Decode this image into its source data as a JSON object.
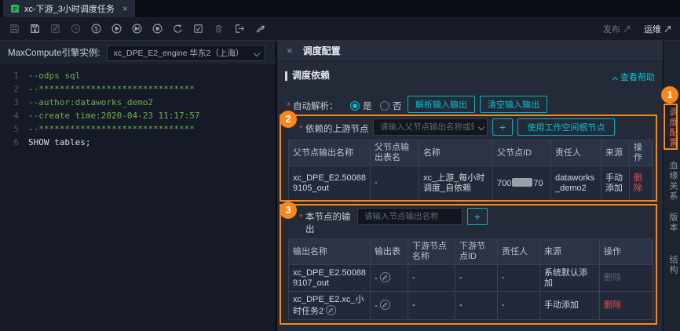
{
  "colors": {
    "accent_teal": "#00c4d6",
    "annotation_orange": "#f8871b",
    "danger_red": "#e2504c",
    "comment_green": "#6fae4e"
  },
  "tab_bar": {
    "active_tab": {
      "icon": "sql-node-icon",
      "title": "xc-下游_3小时调度任务",
      "close": "×"
    }
  },
  "toolbar": {
    "icons": [
      "save-icon",
      "save-commit-icon",
      "steal-lock-icon",
      "clock-icon",
      "cost-estimate-icon",
      "run-icon",
      "advanced-run-icon",
      "stop-icon",
      "refresh-icon",
      "syntax-check-icon",
      "clear-icon",
      "format-icon",
      "settings-wrench-icon"
    ],
    "publish_link": {
      "label": "发布",
      "arrow": "↗"
    },
    "ops_link": {
      "label": "运维",
      "arrow": "↗"
    }
  },
  "editor": {
    "engine_label": "MaxCompute引擎实例:",
    "engine_value": "xc_DPE_E2_engine 华东2（上海）",
    "lines": [
      {
        "no": "1",
        "text": "--odps sql"
      },
      {
        "no": "2",
        "text": "--******************************"
      },
      {
        "no": "3",
        "text": "--author:dataworks_demo2"
      },
      {
        "no": "4",
        "text": "--create time:2020-04-23 11:17:57"
      },
      {
        "no": "5",
        "text": "--******************************"
      },
      {
        "no": "6",
        "text": "SHOW tables;"
      }
    ]
  },
  "panel": {
    "close": "×",
    "title": "调度配置",
    "section": {
      "title": "调度依赖",
      "help": "查看帮助"
    },
    "auto_parse": {
      "required": "*",
      "label": "自动解析：",
      "option_yes": "是",
      "option_no": "否",
      "parse_button": "解析输入输出",
      "clear_button": "清空输入输出"
    },
    "upstream": {
      "required": "*",
      "label": "依赖的上游节点",
      "input_placeholder": "请输入父节点输出名称或输出表名",
      "add_button": "+",
      "root_button": "使用工作空间根节点",
      "headers": [
        "父节点输出名称",
        "父节点输出表名",
        "名称",
        "父节点ID",
        "责任人",
        "来源",
        "操作"
      ],
      "row": {
        "output_name": "xc_DPE_E2.500889105_out",
        "output_table": "-",
        "name": "xc_上游_每小时调度_自依赖",
        "parent_id_prefix": "700",
        "parent_id_suffix": "70",
        "owner": "dataworks_demo2",
        "source": "手动添加",
        "action": "删除"
      }
    },
    "outputs": {
      "required": "*",
      "label": "本节点的输出",
      "input_placeholder": "请输入节点输出名称",
      "add_button": "+",
      "headers": [
        "输出名称",
        "输出表",
        "下游节点名称",
        "下游节点ID",
        "责任人",
        "来源",
        "操作"
      ],
      "rows": [
        {
          "name": "xc_DPE_E2.500889107_out",
          "table": "-",
          "downstream_name": "-",
          "downstream_id": "-",
          "owner": "-",
          "source": "系统默认添加",
          "action": "删除"
        },
        {
          "name": "xc_DPE_E2.xc_小时任务2",
          "table": "-",
          "downstream_name": "-",
          "downstream_id": "-",
          "owner": "-",
          "source": "手动添加",
          "action": "删除"
        }
      ]
    }
  },
  "right_tabs": [
    {
      "label": "调度配置",
      "active": true
    },
    {
      "label": "血缘关系",
      "active": false
    },
    {
      "label": "版本",
      "active": false
    },
    {
      "label": "结构",
      "active": false
    }
  ],
  "annotations": {
    "badge1": "1",
    "badge2": "2",
    "badge3": "3"
  }
}
